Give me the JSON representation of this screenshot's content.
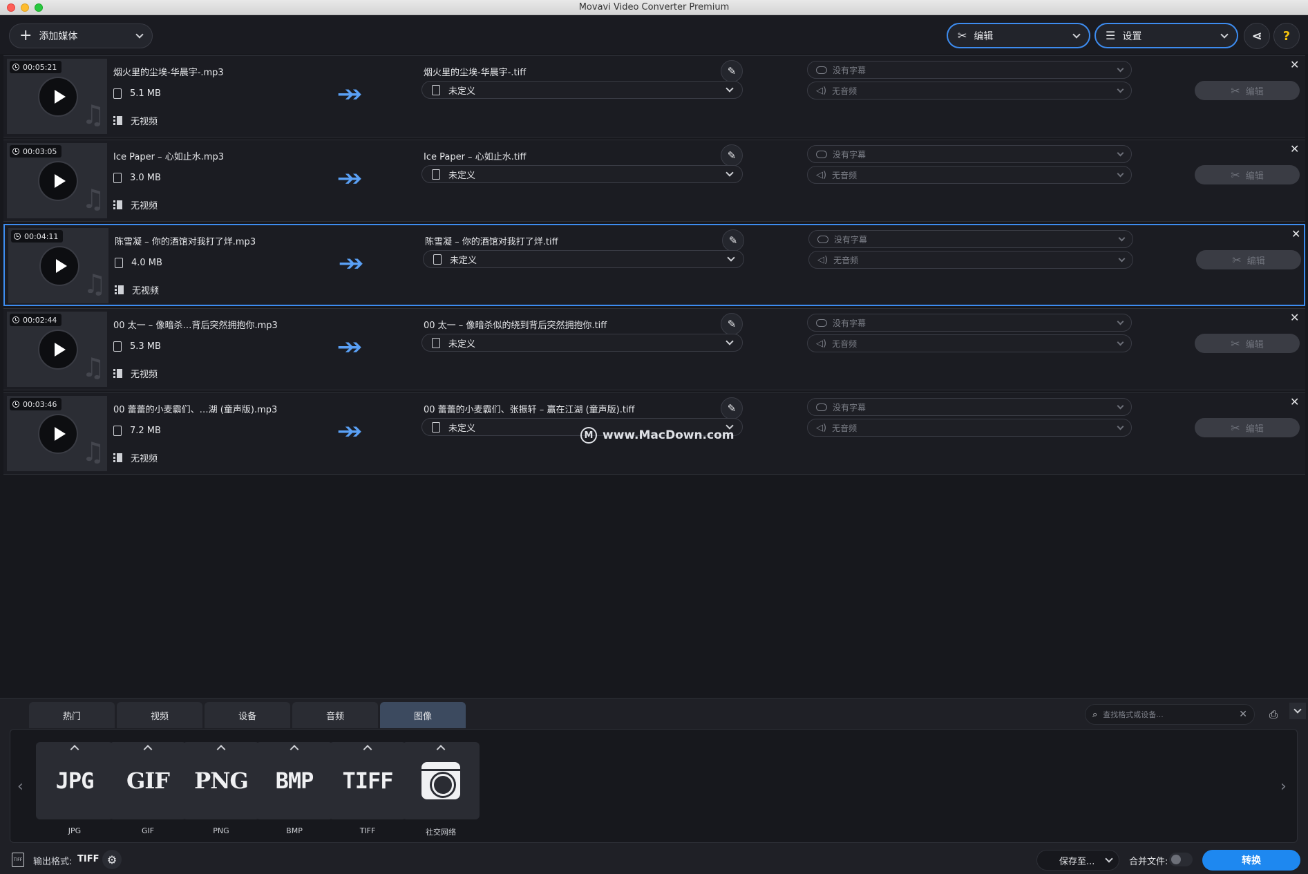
{
  "window": {
    "title": "Movavi Video Converter Premium"
  },
  "toolbar": {
    "add_media_label": "添加媒体",
    "edit_label": "编辑",
    "settings_label": "设置"
  },
  "rows": [
    {
      "duration": "00:05:21",
      "source_name": "烟火里的尘埃-华晨宇-.mp3",
      "size": "5.1 MB",
      "no_video": "无视频",
      "output_name": "烟火里的尘埃-华晨宇-.tiff",
      "profile": "未定义",
      "subtitle": "没有字幕",
      "audio": "无音频",
      "edit_label": "编辑"
    },
    {
      "duration": "00:03:05",
      "source_name": "Ice Paper – 心如止水.mp3",
      "size": "3.0 MB",
      "no_video": "无视频",
      "output_name": "Ice Paper – 心如止水.tiff",
      "profile": "未定义",
      "subtitle": "没有字幕",
      "audio": "无音频",
      "edit_label": "编辑"
    },
    {
      "duration": "00:04:11",
      "source_name": "陈雪凝 – 你的酒馆对我打了烊.mp3",
      "size": "4.0 MB",
      "no_video": "无视频",
      "output_name": "陈雪凝 – 你的酒馆对我打了烊.tiff",
      "profile": "未定义",
      "subtitle": "没有字幕",
      "audio": "无音频",
      "edit_label": "编辑"
    },
    {
      "duration": "00:02:44",
      "source_name": "00 太一 – 像暗杀…背后突然拥抱你.mp3",
      "size": "5.3 MB",
      "no_video": "无视频",
      "output_name": "00 太一 – 像暗杀似的绕到背后突然拥抱你.tiff",
      "profile": "未定义",
      "subtitle": "没有字幕",
      "audio": "无音频",
      "edit_label": "编辑"
    },
    {
      "duration": "00:03:46",
      "source_name": "00 蕾蕾的小麦霸们、…湖 (童声版).mp3",
      "size": "7.2 MB",
      "no_video": "无视频",
      "output_name": "00 蕾蕾的小麦霸们、张振轩 – 赢在江湖 (童声版).tiff",
      "profile": "未定义",
      "subtitle": "没有字幕",
      "audio": "无音频",
      "edit_label": "编辑"
    }
  ],
  "watermark": {
    "text": "www.MacDown.com"
  },
  "bottom": {
    "tabs": [
      "热门",
      "视频",
      "设备",
      "音频",
      "图像"
    ],
    "active_tab": "图像",
    "search_placeholder": "查找格式或设备...",
    "formats": [
      {
        "art": "JPG",
        "caption": "JPG"
      },
      {
        "art": "GIF",
        "caption": "GIF"
      },
      {
        "art": "PNG",
        "caption": "PNG"
      },
      {
        "art": "BMP",
        "caption": "BMP"
      },
      {
        "art": "TIFF",
        "caption": "TIFF"
      },
      {
        "art": "",
        "caption": "社交网络"
      }
    ],
    "footer": {
      "format_icon_text": "TIFF",
      "output_label": "输出格式:",
      "output_value": "TIFF",
      "save_to_label": "保存至...",
      "merge_label": "合并文件:",
      "convert_label": "转换"
    }
  },
  "colors": {
    "accent": "#3d8cf0",
    "convert": "#1e88f0",
    "background": "#17181d"
  }
}
